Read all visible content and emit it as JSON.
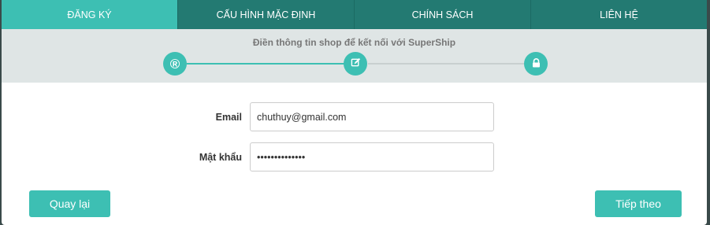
{
  "tabs": [
    {
      "label": "ĐĂNG KÝ",
      "active": true
    },
    {
      "label": "CẤU HÌNH MẶC ĐỊNH",
      "active": false
    },
    {
      "label": "CHÍNH SÁCH",
      "active": false
    },
    {
      "label": "LIÊN HỆ",
      "active": false
    }
  ],
  "wizard": {
    "title": "Điền thông tin shop để kết nối với SuperShip",
    "steps": [
      {
        "icon": "registered-icon",
        "glyph": "®"
      },
      {
        "icon": "edit-icon",
        "glyph": "✎"
      },
      {
        "icon": "lock-icon",
        "glyph": ""
      }
    ]
  },
  "form": {
    "email_label": "Email",
    "email_value": "chuthuy@gmail.com",
    "password_label": "Mật khẩu",
    "password_value": "••••••••••••••"
  },
  "buttons": {
    "back_label": "Quay lại",
    "next_label": "Tiếp theo"
  },
  "colors": {
    "accent": "#3dbfb3",
    "tab_bar": "#237a72",
    "step_bg": "#dfe5e5",
    "inactive_line": "#c8cfcf"
  }
}
